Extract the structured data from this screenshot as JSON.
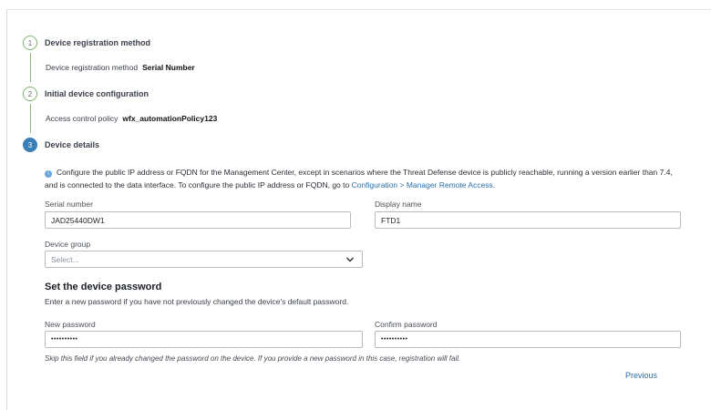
{
  "steps": [
    {
      "number": "1",
      "title": "Device registration method",
      "summary_label": "Device registration method",
      "summary_value": "Serial Number"
    },
    {
      "number": "2",
      "title": "Initial device configuration",
      "summary_label": "Access control policy",
      "summary_value": "wfx_automationPolicy123"
    },
    {
      "number": "3",
      "title": "Device details"
    }
  ],
  "info": {
    "text": "Configure the public IP address or FQDN for the Management Center, except in scenarios where the Threat Defense device is publicly reachable, running a version earlier than 7.4, and is connected to the data interface. To configure the public IP address or FQDN, go to ",
    "link": "Configuration > Manager Remote Access",
    "end": "."
  },
  "form": {
    "serial_label": "Serial number",
    "serial_value": "JAD25440DW1",
    "display_label": "Display name",
    "display_value": "FTD1",
    "group_label": "Device group",
    "group_placeholder": "Select..."
  },
  "password": {
    "title": "Set the device password",
    "subtitle": "Enter a new password if you have not previously changed the device's default password.",
    "new_label": "New password",
    "new_value": "••••••••••",
    "confirm_label": "Confirm password",
    "confirm_value": "••••••••••",
    "hint": "Skip this field if you already changed the password on the device. If you provide a new password in this case, registration will fail."
  },
  "actions": {
    "previous": "Previous"
  },
  "colors": {
    "accent": "#3a7fb8",
    "step_done": "#88c06f",
    "link": "#2b6fa8"
  }
}
